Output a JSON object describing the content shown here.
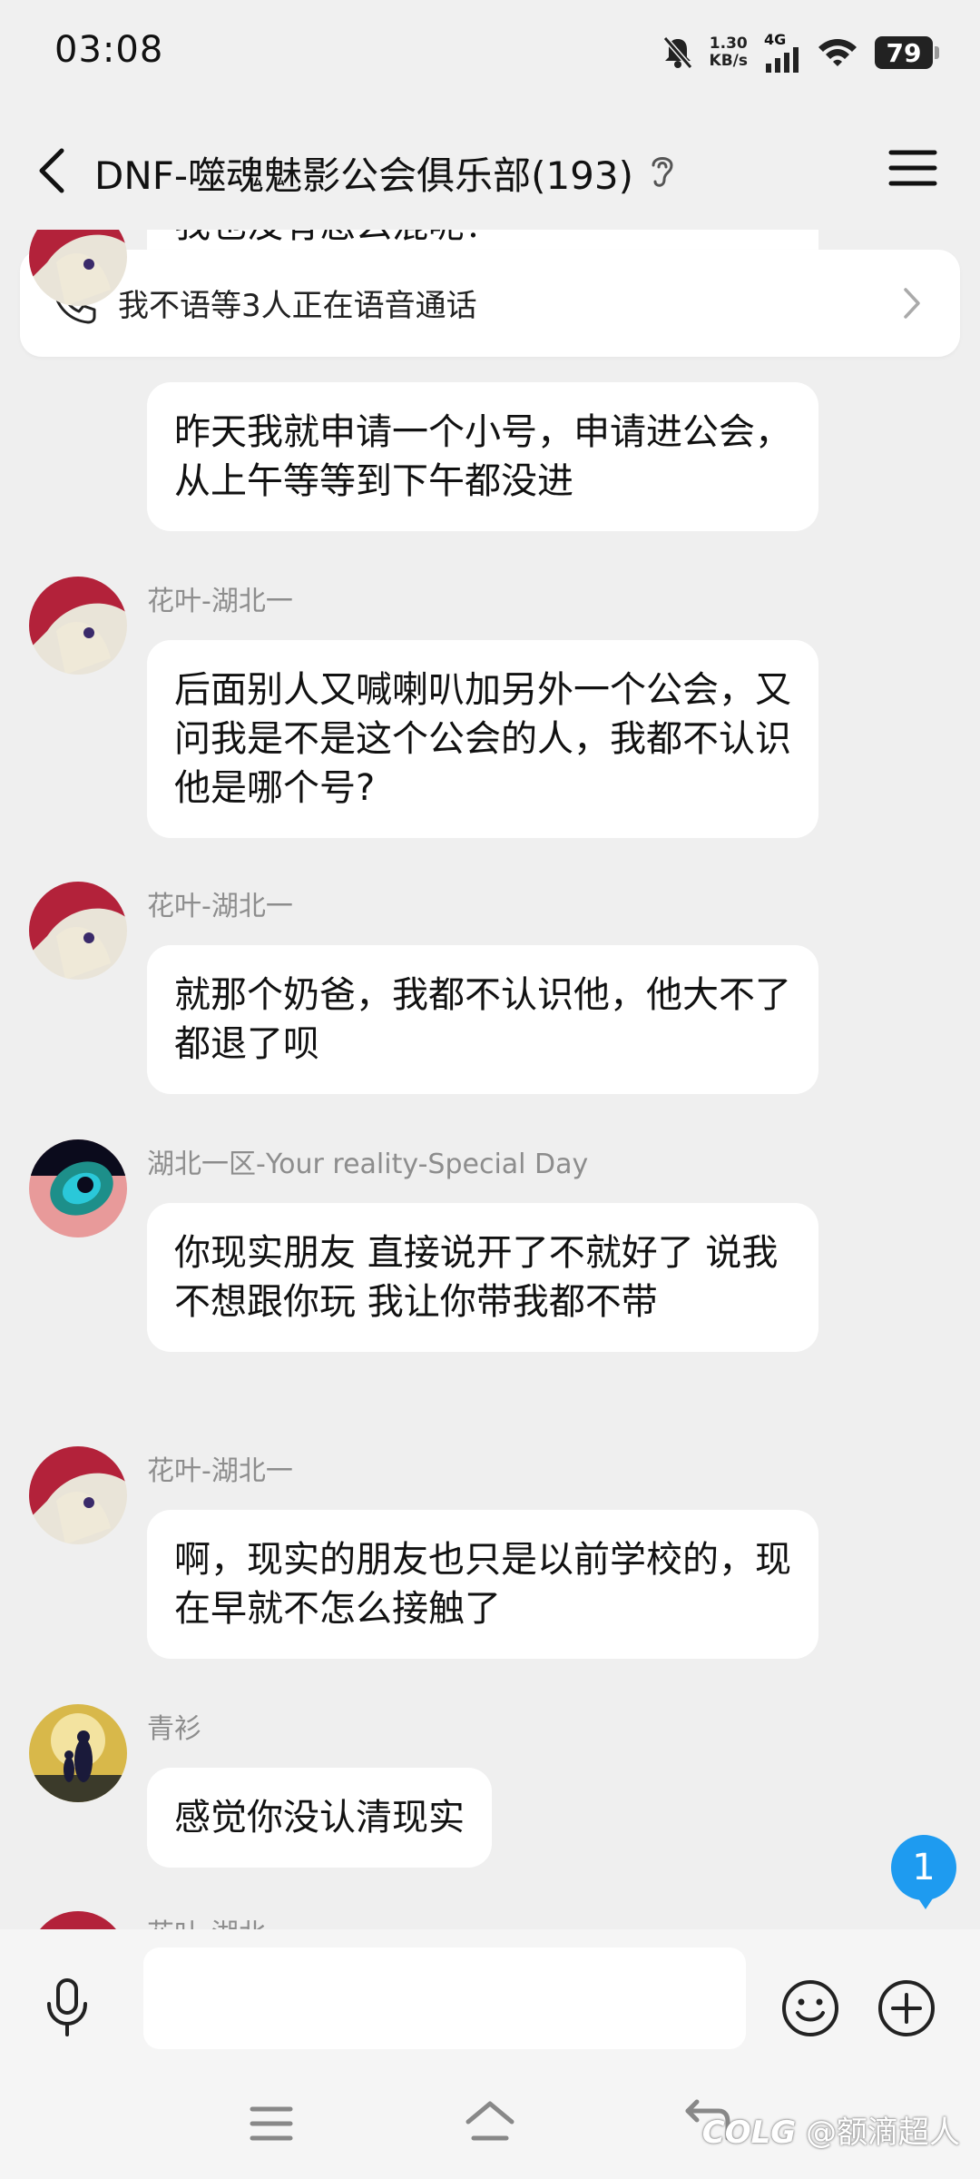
{
  "status_bar": {
    "time": "03:08",
    "net_speed_value": "1.30",
    "net_speed_unit": "KB/s",
    "network_type": "4G",
    "battery": "79",
    "icons": [
      "bell-off-icon",
      "signal-icon",
      "wifi-icon",
      "battery-icon"
    ]
  },
  "header": {
    "title": "DNF-噬魂魅影公会俱乐部(193)",
    "icons": [
      "back-icon",
      "ear-icon",
      "menu-icon"
    ]
  },
  "voice_banner": {
    "text": "我不语等3人正在语音通话"
  },
  "partial_top_message": "我也没有怎么混呢？",
  "messages": [
    {
      "sender": "",
      "text": "昨天我就申请一个小号，申请进公会，从上午等等到下午都没进"
    },
    {
      "sender": "花叶-湖北一",
      "text": "后面别人又喊喇叭加另外一个公会，又问我是不是这个公会的人，我都不认识他是哪个号?"
    },
    {
      "sender": "花叶-湖北一",
      "text": "就那个奶爸，我都不认识他，他大不了都退了呗"
    },
    {
      "sender": "湖北一区-Your reality-Special Day",
      "text": "你现实朋友 直接说开了不就好了 说我不想跟你玩 我让你带我都不带"
    },
    {
      "sender": "花叶-湖北一",
      "text": "啊，现实的朋友也只是以前学校的，现在早就不怎么接触了"
    },
    {
      "sender": "青衫",
      "text": "感觉你没认清现实"
    }
  ],
  "partial_bottom_sender": "花叶-湖北一",
  "unread_count": "1",
  "input": {
    "value": "",
    "placeholder": ""
  },
  "watermark": "@额滴超人",
  "watermark_brand": "COLG",
  "colors": {
    "background": "#efefef",
    "bubble": "#ffffff",
    "accent": "#1e9bf0",
    "sender_name": "#8d8d8d"
  }
}
